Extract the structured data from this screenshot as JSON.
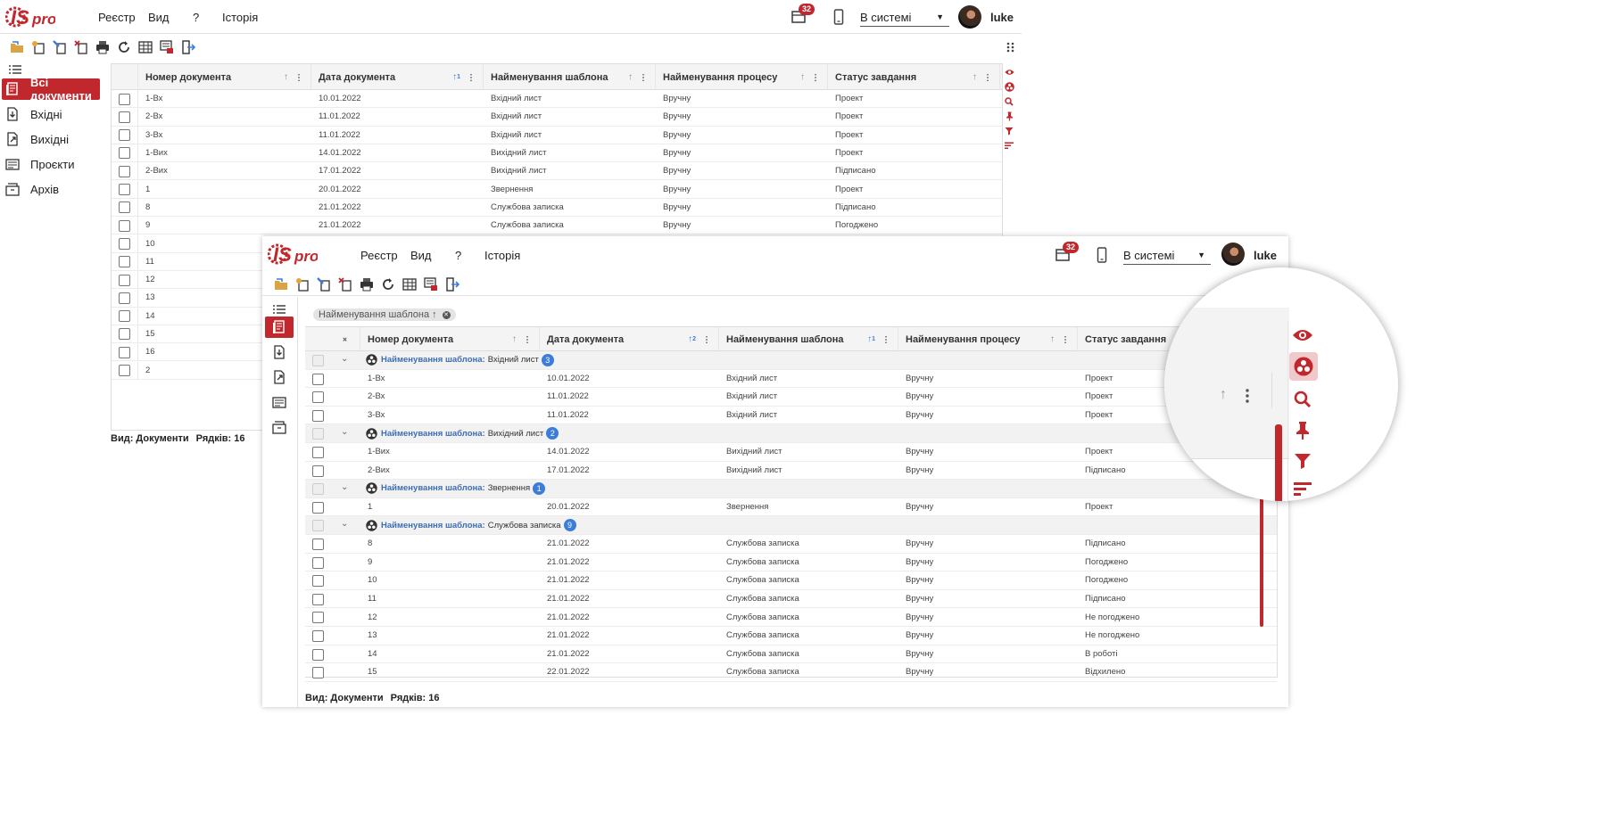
{
  "brand": {
    "logo_text": "ISpro",
    "accent": "#c0282d",
    "link_blue": "#3d6db5",
    "badge_blue": "#3b7dd8"
  },
  "menu": [
    "Реєстр",
    "Вид",
    "?",
    "Історія"
  ],
  "header": {
    "notifications_count": "32",
    "status_value": "В системі",
    "user_name": "luke"
  },
  "toolbar_icons": [
    "open-folder-icon",
    "new-document-icon",
    "edit-document-icon",
    "delete-document-icon",
    "print-icon",
    "refresh-icon",
    "table-icon",
    "export-icon",
    "exit-icon"
  ],
  "nav": [
    {
      "label": "Всі документи",
      "icon": "all-documents-icon",
      "active": true
    },
    {
      "label": "Вхідні",
      "icon": "incoming-icon",
      "active": false
    },
    {
      "label": "Вихідні",
      "icon": "outgoing-icon",
      "active": false
    },
    {
      "label": "Проєкти",
      "icon": "projects-icon",
      "active": false
    },
    {
      "label": "Архів",
      "icon": "archive-icon",
      "active": false
    }
  ],
  "columns": [
    "Номер документа",
    "Дата документа",
    "Найменування шаблона",
    "Найменування процесу",
    "Статус завдання"
  ],
  "back_window": {
    "sort_badge": "1",
    "rows": [
      [
        "1-Вх",
        "10.01.2022",
        "Вхідний лист",
        "Вручну",
        "Проект"
      ],
      [
        "2-Вх",
        "11.01.2022",
        "Вхідний лист",
        "Вручну",
        "Проект"
      ],
      [
        "3-Вх",
        "11.01.2022",
        "Вхідний лист",
        "Вручну",
        "Проект"
      ],
      [
        "1-Вих",
        "14.01.2022",
        "Вихідний лист",
        "Вручну",
        "Проект"
      ],
      [
        "2-Вих",
        "17.01.2022",
        "Вихідний лист",
        "Вручну",
        "Підписано"
      ],
      [
        "1",
        "20.01.2022",
        "Звернення",
        "Вручну",
        "Проект"
      ],
      [
        "8",
        "21.01.2022",
        "Службова записка",
        "Вручну",
        "Підписано"
      ],
      [
        "9",
        "21.01.2022",
        "Службова записка",
        "Вручну",
        "Погоджено"
      ],
      [
        "10",
        "",
        "",
        "",
        ""
      ],
      [
        "11",
        "",
        "",
        "",
        ""
      ],
      [
        "12",
        "",
        "",
        "",
        ""
      ],
      [
        "13",
        "",
        "",
        "",
        ""
      ],
      [
        "14",
        "",
        "",
        "",
        ""
      ],
      [
        "15",
        "",
        "",
        "",
        ""
      ],
      [
        "16",
        "",
        "",
        "",
        ""
      ],
      [
        "2",
        "",
        "",
        "",
        ""
      ]
    ],
    "footer_view": "Вид: Документи",
    "footer_rows": "Рядків: 16"
  },
  "front_window": {
    "group_chip": "Найменування шаблона",
    "date_sort_badge": "2",
    "template_sort_badge": "1",
    "group_label": "Найменування шаблона:",
    "groups": [
      {
        "value": "Вхідний лист",
        "count": "3",
        "rows": [
          [
            "1-Вх",
            "10.01.2022",
            "Вхідний лист",
            "Вручну",
            "Проект"
          ],
          [
            "2-Вх",
            "11.01.2022",
            "Вхідний лист",
            "Вручну",
            "Проект"
          ],
          [
            "3-Вх",
            "11.01.2022",
            "Вхідний лист",
            "Вручну",
            "Проект"
          ]
        ]
      },
      {
        "value": "Вихідний лист",
        "count": "2",
        "rows": [
          [
            "1-Вих",
            "14.01.2022",
            "Вихідний лист",
            "Вручну",
            "Проект"
          ],
          [
            "2-Вих",
            "17.01.2022",
            "Вихідний лист",
            "Вручну",
            "Підписано"
          ]
        ]
      },
      {
        "value": "Звернення",
        "count": "1",
        "rows": [
          [
            "1",
            "20.01.2022",
            "Звернення",
            "Вручну",
            "Проект"
          ]
        ]
      },
      {
        "value": "Службова записка",
        "count": "9",
        "rows": [
          [
            "8",
            "21.01.2022",
            "Службова записка",
            "Вручну",
            "Підписано"
          ],
          [
            "9",
            "21.01.2022",
            "Службова записка",
            "Вручну",
            "Погоджено"
          ],
          [
            "10",
            "21.01.2022",
            "Службова записка",
            "Вручну",
            "Погоджено"
          ],
          [
            "11",
            "21.01.2022",
            "Службова записка",
            "Вручну",
            "Підписано"
          ],
          [
            "12",
            "21.01.2022",
            "Службова записка",
            "Вручну",
            "Не погоджено"
          ],
          [
            "13",
            "21.01.2022",
            "Службова записка",
            "Вручну",
            "Не погоджено"
          ],
          [
            "14",
            "21.01.2022",
            "Службова записка",
            "Вручну",
            "В роботі"
          ],
          [
            "15",
            "22.01.2022",
            "Службова записка",
            "Вручну",
            "Відхилено"
          ]
        ]
      }
    ],
    "footer_view": "Вид: Документи",
    "footer_rows": "Рядків: 16"
  },
  "right_panel_icons": [
    "eye-icon",
    "group-icon",
    "search-icon",
    "pin-icon",
    "filter-icon",
    "sort-icon"
  ]
}
